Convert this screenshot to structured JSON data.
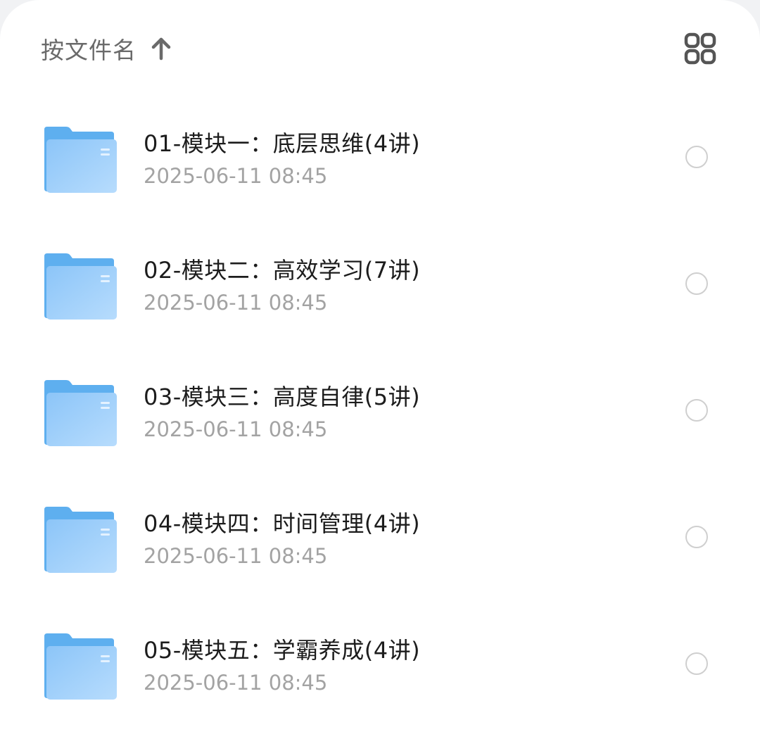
{
  "sort": {
    "label": "按文件名",
    "direction_icon": "arrow-up-icon"
  },
  "view_toggle": {
    "icon": "grid-view-icon"
  },
  "colors": {
    "folder_light": "#a8d3fb",
    "folder_dark": "#5eafef",
    "text_primary": "#1c1c1c",
    "text_secondary": "#a3a3a3",
    "radio_border": "#cfcfcf"
  },
  "files": [
    {
      "name": "01-模块一：底层思维(4讲)",
      "date": "2025-06-11 08:45",
      "icon": "folder-icon",
      "selected": false
    },
    {
      "name": "02-模块二：高效学习(7讲)",
      "date": "2025-06-11 08:45",
      "icon": "folder-icon",
      "selected": false
    },
    {
      "name": "03-模块三：高度自律(5讲)",
      "date": "2025-06-11 08:45",
      "icon": "folder-icon",
      "selected": false
    },
    {
      "name": "04-模块四：时间管理(4讲)",
      "date": "2025-06-11 08:45",
      "icon": "folder-icon",
      "selected": false
    },
    {
      "name": "05-模块五：学霸养成(4讲)",
      "date": "2025-06-11 08:45",
      "icon": "folder-icon",
      "selected": false
    }
  ]
}
